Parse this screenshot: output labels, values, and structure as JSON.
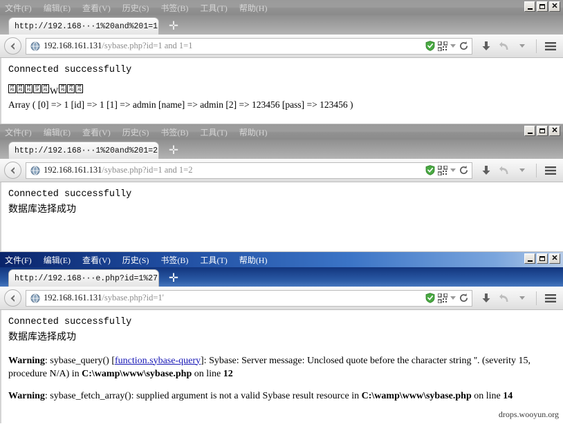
{
  "menu": {
    "items": [
      {
        "label": "文件",
        "accel": "(F)"
      },
      {
        "label": "编辑",
        "accel": "(E)"
      },
      {
        "label": "查看",
        "accel": "(V)"
      },
      {
        "label": "历史",
        "accel": "(S)"
      },
      {
        "label": "书签",
        "accel": "(B)"
      },
      {
        "label": "工具",
        "accel": "(T)"
      },
      {
        "label": "帮助",
        "accel": "(H)"
      }
    ],
    "window_controls": {
      "minimize": "minimize-button",
      "maximize": "maximize-button",
      "close": "close-button",
      "close_glyph": "✕"
    }
  },
  "toolbar": {
    "back_glyph": "←",
    "new_tab_glyph": "✛",
    "shield_icon": "green-shield-icon",
    "qr_icon": "qr-code-icon",
    "reload_glyph": "⟳",
    "download_glyph": "⬇",
    "history_glyph": "↰",
    "menu_glyph": "☰"
  },
  "windows": [
    {
      "id": "window-1",
      "active": false,
      "tab_title": "http://192.168···1%20and%201=1",
      "url_host": "192.168.161.131",
      "url_path": "/sybase.php?id=1 and 1=1",
      "content": {
        "line1": "Connected successfully",
        "line2_mojibake": [
          "FFFD",
          "FFFD",
          "FFFD",
          "073F",
          "FFFD",
          "W",
          "FFFD",
          "FFFD",
          "FFFD"
        ],
        "line3": "Array ( [0] => 1 [id] => 1 [1] => admin [name] => admin [2] => 123456 [pass] => 123456 )"
      }
    },
    {
      "id": "window-2",
      "active": false,
      "tab_title": "http://192.168···1%20and%201=2",
      "url_host": "192.168.161.131",
      "url_path": "/sybase.php?id=1 and 1=2",
      "content": {
        "line1": "Connected successfully",
        "line2": "数据库选择成功"
      }
    },
    {
      "id": "window-3",
      "active": true,
      "tab_title": "http://192.168···e.php?id=1%27",
      "url_host": "192.168.161.131",
      "url_path": "/sybase.php?id=1'",
      "content": {
        "line1": "Connected successfully",
        "line2": "数据库选择成功",
        "warning1": {
          "label": "Warning",
          "func": ": sybase_query() [",
          "link": "function.sybase-query",
          "text_after": "]: Sybase: Server message: Unclosed quote before the character string ''. (severity 15, procedure N/A) in ",
          "path": "C:\\wamp\\www\\sybase.php",
          "tail": " on line ",
          "line_no": "12"
        },
        "warning2": {
          "label": "Warning",
          "text": ": sybase_fetch_array(): supplied argument is not a valid Sybase result resource in ",
          "path": "C:\\wamp\\www\\sybase.php",
          "tail": " on line ",
          "line_no": "14"
        }
      },
      "watermark": "drops.wooyun.org"
    }
  ],
  "colors": {
    "active_titlebar": "#0a246a",
    "inactive_titlebar": "#9a9a9a",
    "link": "#1414b4",
    "shield_green": "#4caf50"
  }
}
